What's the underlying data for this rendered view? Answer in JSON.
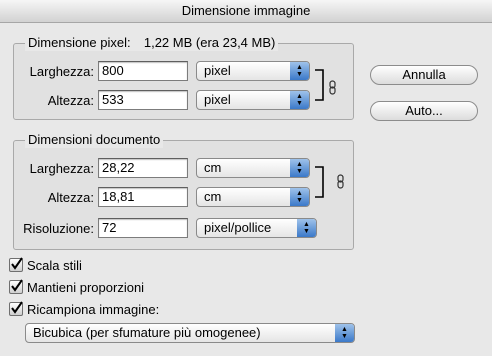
{
  "window": {
    "title": "Dimensione immagine"
  },
  "pixel_dimensions": {
    "legend": "Dimensione pixel:",
    "size": "1,22 MB (era 23,4 MB)",
    "width_label": "Larghezza:",
    "width_value": "800",
    "width_unit": "pixel",
    "height_label": "Altezza:",
    "height_value": "533",
    "height_unit": "pixel"
  },
  "document_size": {
    "legend": "Dimensioni documento",
    "width_label": "Larghezza:",
    "width_value": "28,22",
    "width_unit": "cm",
    "height_label": "Altezza:",
    "height_value": "18,81",
    "height_unit": "cm",
    "resolution_label": "Risoluzione:",
    "resolution_value": "72",
    "resolution_unit": "pixel/pollice"
  },
  "buttons": {
    "cancel": "Annulla",
    "auto": "Auto..."
  },
  "options": {
    "scale_styles": {
      "label": "Scala stili",
      "checked": true
    },
    "constrain_proportions": {
      "label": "Mantieni proporzioni",
      "checked": true
    },
    "resample": {
      "label": "Ricampiona immagine:",
      "checked": true
    }
  },
  "resample_method": {
    "selected": "Bicubica (per sfumature più omogenee)"
  },
  "icons": {
    "link": "chain-link-icon",
    "popup": "up-down-arrows-icon",
    "check": "checkmark-icon"
  }
}
